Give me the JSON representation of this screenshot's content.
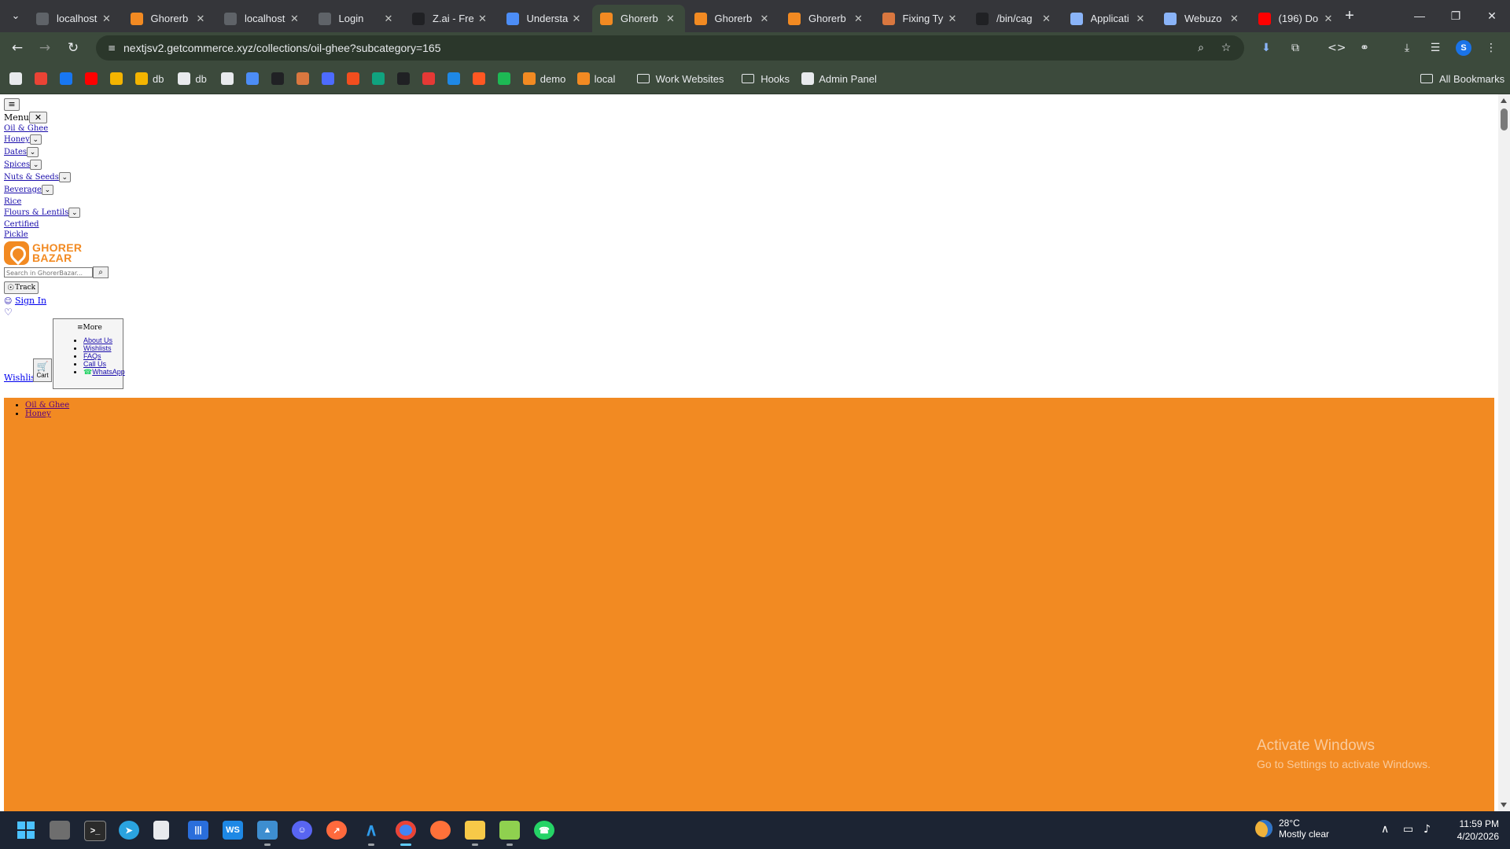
{
  "browser": {
    "tabs": [
      {
        "title": "localhost",
        "favicon": "page-icon",
        "color": "#5f6368"
      },
      {
        "title": "Ghorerb",
        "favicon": "ghorer-icon",
        "color": "#f28a22"
      },
      {
        "title": "localhost",
        "favicon": "page-icon",
        "color": "#5f6368"
      },
      {
        "title": "Login",
        "favicon": "page-icon",
        "color": "#5f6368"
      },
      {
        "title": "Z.ai - Fre",
        "favicon": "z-icon",
        "color": "#202124"
      },
      {
        "title": "Understa",
        "favicon": "gemini-icon",
        "color": "#4c8df6"
      },
      {
        "title": "Ghorerb",
        "favicon": "ghorer-icon",
        "color": "#f28a22",
        "active": true
      },
      {
        "title": "Ghorerb",
        "favicon": "ghorer-icon",
        "color": "#f28a22"
      },
      {
        "title": "Ghorerb",
        "favicon": "ghorer-icon",
        "color": "#f28a22"
      },
      {
        "title": "Fixing Ty",
        "favicon": "claude-icon",
        "color": "#d9773f"
      },
      {
        "title": "/bin/cag",
        "favicon": "terminal-icon",
        "color": "#202124"
      },
      {
        "title": "Applicati",
        "favicon": "cloud-icon",
        "color": "#8ab4f8"
      },
      {
        "title": "Webuzo",
        "favicon": "cloud-icon",
        "color": "#8ab4f8"
      },
      {
        "title": "(196) Do",
        "favicon": "youtube-icon",
        "color": "#ff0000"
      }
    ],
    "url": "nextjsv2.getcommerce.xyz/collections/oil-ghee?subcategory=165",
    "profile_initial": "S",
    "bookmarks": [
      {
        "label": "",
        "icon": "apps-grid-icon",
        "color": "#e8eaed"
      },
      {
        "label": "",
        "icon": "gmail-icon",
        "color": "#ea4335"
      },
      {
        "label": "",
        "icon": "facebook-icon",
        "color": "#1877f2"
      },
      {
        "label": "",
        "icon": "youtube-icon",
        "color": "#ff0000"
      },
      {
        "label": "",
        "icon": "drive-icon",
        "color": "#f4b400"
      },
      {
        "label": "db",
        "icon": "drive-icon",
        "color": "#f4b400"
      },
      {
        "label": "db",
        "icon": "globe-icon",
        "color": "#e8eaed"
      },
      {
        "label": "",
        "icon": "openai-icon",
        "color": "#e8eaed"
      },
      {
        "label": "",
        "icon": "gemini-icon",
        "color": "#4c8df6"
      },
      {
        "label": "",
        "icon": "z-icon",
        "color": "#202124"
      },
      {
        "label": "",
        "icon": "claude-icon",
        "color": "#d9773f"
      },
      {
        "label": "",
        "icon": "deepseek-icon",
        "color": "#4d6bfe"
      },
      {
        "label": "",
        "icon": "figma-icon",
        "color": "#f24e1e"
      },
      {
        "label": "",
        "icon": "copilot-icon",
        "color": "#10a37f"
      },
      {
        "label": "",
        "icon": "media-icon",
        "color": "#202124"
      },
      {
        "label": "",
        "icon": "png-jpg-icon",
        "color": "#e53935"
      },
      {
        "label": "",
        "icon": "app-icon",
        "color": "#1e88e5"
      },
      {
        "label": "",
        "icon": "firebase-icon",
        "color": "#ff5722"
      },
      {
        "label": "",
        "icon": "w-icon",
        "color": "#1db954"
      },
      {
        "label": "demo",
        "icon": "ghorer-icon",
        "color": "#f28a22"
      },
      {
        "label": "local",
        "icon": "ghorer-icon",
        "color": "#f28a22"
      },
      {
        "label": "Work Websites",
        "icon": "folder-icon",
        "color": "#e8eaed"
      },
      {
        "label": "Hooks",
        "icon": "folder-icon",
        "color": "#e8eaed"
      },
      {
        "label": "Admin Panel",
        "icon": "globe-icon",
        "color": "#e8eaed"
      }
    ],
    "all_bookmarks": "All Bookmarks"
  },
  "site": {
    "menu_label": "Menu",
    "categories": [
      {
        "label": "Oil & Ghee",
        "dropdown": false
      },
      {
        "label": "Honey",
        "dropdown": true
      },
      {
        "label": "Dates",
        "dropdown": true
      },
      {
        "label": "Spices",
        "dropdown": true
      },
      {
        "label": "Nuts & Seeds",
        "dropdown": true
      },
      {
        "label": "Beverage",
        "dropdown": true
      },
      {
        "label": "Rice",
        "dropdown": false
      },
      {
        "label": "Flours & Lentils",
        "dropdown": true
      },
      {
        "label": "Certified",
        "dropdown": false
      },
      {
        "label": "Pickle",
        "dropdown": false
      }
    ],
    "logo_line1": "GHORER",
    "logo_line2": "BAZAR",
    "search_placeholder": "Search in GhorerBazar...",
    "track_label": "Track",
    "sign_in_label": "Sign In",
    "more_label": "More",
    "more_items": [
      "About Us",
      "Wishlists",
      "FAQs",
      "Call Us",
      "WhatsApp"
    ],
    "wishlist_label": "Wishlist",
    "cart_label": "Cart",
    "breadcrumb": [
      "Oil & Ghee",
      "Honey"
    ],
    "banner_color": "#f28a22"
  },
  "watermark": {
    "line1": "Activate Windows",
    "line2": "Go to Settings to activate Windows."
  },
  "taskbar": {
    "weather_temp": "28°C",
    "weather_desc": "Mostly clear",
    "time": "11:59 PM",
    "date": "4/20/2026"
  }
}
